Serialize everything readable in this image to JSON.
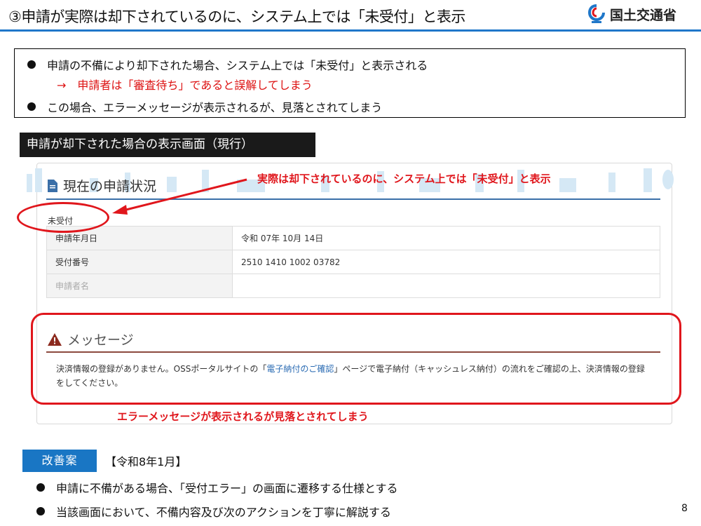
{
  "header": {
    "title": "③申請が実際は却下されているのに、システム上では「未受付」と表示",
    "logo_text": "国土交通省"
  },
  "summary": {
    "line1": "申請の不備により却下された場合、システム上では「未受付」と表示される",
    "line1_sub": "→　申請者は「審査待ち」であると誤解してしまう",
    "line2": "この場合、エラーメッセージが表示されるが、見落とされてしまう"
  },
  "section_label": "申請が却下された場合の表示画面（現行）",
  "screen": {
    "heading": "現在の申請状況",
    "status": "未受付",
    "rows": [
      {
        "label": "申請年月日",
        "value": "令和 07年 10月 14日"
      },
      {
        "label": "受付番号",
        "value": "2510 1410 1002 03782"
      },
      {
        "label": "申請者名",
        "value": ""
      }
    ],
    "message_heading": "メッセージ",
    "message_pre": "決済情報の登録がありません。OSSポータルサイトの「",
    "message_link": "電子納付のご確認",
    "message_post": "」ページで電子納付（キャッシュレス納付）の流れをご確認の上、決済情報の登録をしてください。"
  },
  "annotations": {
    "top": "実際は却下されているのに、システム上では「未受付」と表示",
    "bottom": "エラーメッセージが表示されるが見落とされてしまう"
  },
  "improvement": {
    "label": "改善案",
    "date": "【令和8年1月】",
    "items": [
      "申請に不備がある場合、「受付エラー」の画面に遷移する仕様とする",
      "当該画面において、不備内容及び次のアクションを丁寧に解説する"
    ]
  },
  "page_number": "8",
  "colors": {
    "accent_blue": "#1976c4",
    "annotation_red": "#e0161c"
  }
}
